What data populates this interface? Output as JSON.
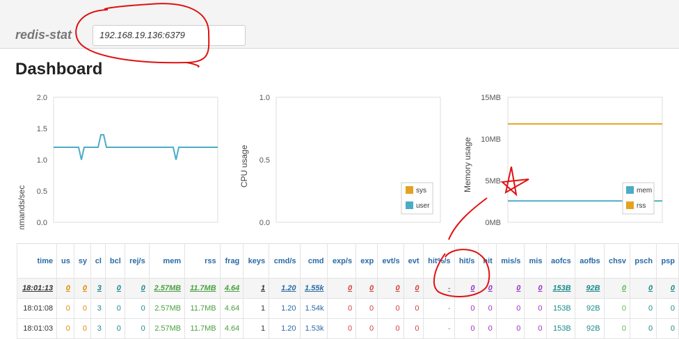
{
  "header": {
    "brand": "redis-stat",
    "host": "192.168.19.136:6379"
  },
  "page": {
    "title": "Dashboard"
  },
  "charts": {
    "commands": {
      "ylabel": "Commands/sec",
      "ticks": [
        "2.0",
        "1.5",
        "1.0",
        "0.5",
        "0.0"
      ]
    },
    "cpu": {
      "ylabel": "CPU usage",
      "ticks": [
        "1.0",
        "0.5",
        "0.0"
      ],
      "legend": [
        "sys",
        "user"
      ]
    },
    "memory": {
      "ylabel": "Memory usage",
      "ticks": [
        "15MB",
        "10MB",
        "5MB",
        "0MB"
      ],
      "legend": [
        "mem",
        "rss"
      ]
    }
  },
  "chart_data": [
    {
      "type": "line",
      "ylabel": "Commands/sec",
      "ylim": [
        0,
        2
      ],
      "grid": false,
      "series": [
        {
          "values": [
            1.2,
            1.2,
            1.2,
            1.2,
            1.2,
            1.2,
            1.2,
            1.2,
            1.2,
            1.2,
            1.0,
            1.2,
            1.2,
            1.2,
            1.2,
            1.2,
            1.2,
            1.4,
            1.4,
            1.2,
            1.2,
            1.2,
            1.2,
            1.2,
            1.2,
            1.2,
            1.2,
            1.2,
            1.2,
            1.2,
            1.2,
            1.2,
            1.2,
            1.2,
            1.2,
            1.2,
            1.2,
            1.2,
            1.2,
            1.2,
            1.2,
            1.2,
            1.2,
            1.2,
            1.0,
            1.2,
            1.2,
            1.2,
            1.2,
            1.2,
            1.2,
            1.2,
            1.2,
            1.2,
            1.2,
            1.2,
            1.2,
            1.2,
            1.2,
            1.2
          ]
        }
      ]
    },
    {
      "type": "area",
      "ylabel": "CPU usage",
      "ylim": [
        0,
        1
      ],
      "legend_position": "bottom-right",
      "series": [
        {
          "name": "sys",
          "values": []
        },
        {
          "name": "user",
          "values": []
        }
      ]
    },
    {
      "type": "line",
      "ylabel": "Memory usage",
      "ylim": [
        0,
        15
      ],
      "legend_position": "bottom-right",
      "series": [
        {
          "name": "rss",
          "values": [
            11.8,
            11.8,
            11.8,
            11.8,
            11.8,
            11.8,
            11.8,
            11.8,
            11.8,
            11.8,
            11.8,
            11.8,
            11.8,
            11.8,
            11.8,
            11.8,
            11.8,
            11.8,
            11.8,
            11.8,
            11.8,
            11.8,
            11.8,
            11.8,
            11.8,
            11.8,
            11.8,
            11.8,
            11.8,
            11.8,
            11.8,
            11.8,
            11.8,
            11.8,
            11.8,
            11.8,
            11.8,
            11.8,
            11.8,
            11.8,
            11.8,
            11.8,
            11.8,
            11.8,
            11.8,
            11.8,
            11.8,
            11.8,
            11.8,
            11.8,
            11.8,
            11.8,
            11.8,
            11.8,
            11.8,
            11.8,
            11.8,
            11.8,
            11.8,
            11.8
          ]
        },
        {
          "name": "mem",
          "values": [
            2.57,
            2.57,
            2.57,
            2.57,
            2.57,
            2.57,
            2.57,
            2.57,
            2.57,
            2.57,
            2.57,
            2.57,
            2.57,
            2.57,
            2.57,
            2.57,
            2.57,
            2.57,
            2.57,
            2.57,
            2.57,
            2.57,
            2.57,
            2.57,
            2.57,
            2.57,
            2.57,
            2.57,
            2.57,
            2.57,
            2.57,
            2.57,
            2.57,
            2.57,
            2.57,
            2.57,
            2.57,
            2.57,
            2.57,
            2.57,
            2.57,
            2.57,
            2.57,
            2.57,
            2.57,
            2.57,
            2.57,
            2.57,
            2.57,
            2.57,
            2.57,
            2.57,
            2.57,
            2.57,
            2.57,
            2.57,
            2.57,
            2.57,
            2.57,
            2.57
          ]
        }
      ]
    }
  ],
  "table": {
    "columns": [
      "time",
      "us",
      "sy",
      "cl",
      "bcl",
      "rej/s",
      "mem",
      "rss",
      "frag",
      "keys",
      "cmd/s",
      "cmd",
      "exp/s",
      "exp",
      "evt/s",
      "evt",
      "hit%/s",
      "hit/s",
      "hit",
      "mis/s",
      "mis",
      "aofcs",
      "aofbs",
      "chsv",
      "psch",
      "psp"
    ],
    "rows": [
      [
        "18:01:13",
        "0",
        "0",
        "3",
        "0",
        "0",
        "2.57MB",
        "11.7MB",
        "4.64",
        "1",
        "1.20",
        "1.55k",
        "0",
        "0",
        "0",
        "0",
        "-",
        "0",
        "0",
        "0",
        "0",
        "153B",
        "92B",
        "0",
        "0",
        "0"
      ],
      [
        "18:01:08",
        "0",
        "0",
        "3",
        "0",
        "0",
        "2.57MB",
        "11.7MB",
        "4.64",
        "1",
        "1.20",
        "1.54k",
        "0",
        "0",
        "0",
        "0",
        "-",
        "0",
        "0",
        "0",
        "0",
        "153B",
        "92B",
        "0",
        "0",
        "0"
      ],
      [
        "18:01:03",
        "0",
        "0",
        "3",
        "0",
        "0",
        "2.57MB",
        "11.7MB",
        "4.64",
        "1",
        "1.20",
        "1.53k",
        "0",
        "0",
        "0",
        "0",
        "-",
        "0",
        "0",
        "0",
        "0",
        "153B",
        "92B",
        "0",
        "0",
        "0"
      ]
    ]
  },
  "colors": {
    "line_blue": "#4bacc6",
    "line_orange": "#e5a21f",
    "annotation_red": "#e01010"
  }
}
